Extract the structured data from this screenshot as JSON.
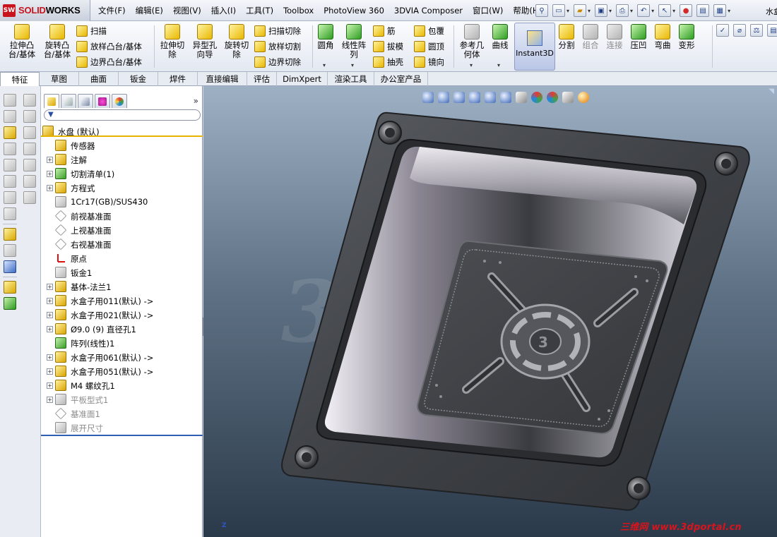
{
  "app": {
    "logo_text_prefix": "SOLID",
    "logo_text_suffix": "WORKS",
    "document_title": "水盒"
  },
  "menus": [
    "文件(F)",
    "编辑(E)",
    "视图(V)",
    "插入(I)",
    "工具(T)",
    "Toolbox",
    "PhotoView 360",
    "3DVIA Composer",
    "窗口(W)",
    "帮助(H)"
  ],
  "ribbon": {
    "extrude_boss": "拉伸凸\n台/基体",
    "revolve_boss": "旋转凸\n台/基体",
    "sweep": "扫描",
    "loft_boss": "放样凸台/基体",
    "boundary_boss": "边界凸台/基体",
    "extrude_cut": "拉伸切\n除",
    "hole_wizard": "异型孔\n向导",
    "revolve_cut": "旋转切\n除",
    "swept_cut": "扫描切除",
    "lofted_cut": "放样切割",
    "boundary_cut": "边界切除",
    "fillet": "圆角",
    "linear_pattern": "线性阵\n列",
    "rib": "筋",
    "draft": "拔模",
    "shell": "抽壳",
    "wrap": "包覆",
    "dome": "圆顶",
    "mirror": "镜向",
    "reference_geometry": "参考几\n何体",
    "curves": "曲线",
    "instant3d": "Instant3D",
    "split": "分割",
    "combine": "组合",
    "join": "连接",
    "indent": "压凹",
    "flex": "弯曲",
    "deform": "变形"
  },
  "tabs": [
    "特征",
    "草图",
    "曲面",
    "钣金",
    "焊件",
    "直接编辑",
    "评估",
    "DimXpert",
    "渲染工具",
    "办公室产品"
  ],
  "feature_tree": {
    "expand_label": "»",
    "root": "水盘  (默认)",
    "items": [
      {
        "label": "传感器",
        "icon": "sensor-icon",
        "expand": false,
        "dim": false
      },
      {
        "label": "注解",
        "icon": "annotations-icon",
        "expand": true,
        "dim": false
      },
      {
        "label": "切割清单(1)",
        "icon": "cut-list-icon",
        "expand": true,
        "dim": false
      },
      {
        "label": "方程式",
        "icon": "equations-icon",
        "expand": true,
        "dim": false
      },
      {
        "label": "1Cr17(GB)/SUS430",
        "icon": "material-icon",
        "expand": false,
        "dim": false
      },
      {
        "label": "前视基准面",
        "icon": "plane-icon",
        "expand": false,
        "dim": false
      },
      {
        "label": "上视基准面",
        "icon": "plane-icon",
        "expand": false,
        "dim": false
      },
      {
        "label": "右视基准面",
        "icon": "plane-icon",
        "expand": false,
        "dim": false
      },
      {
        "label": "原点",
        "icon": "origin-icon",
        "expand": false,
        "dim": false
      },
      {
        "label": "钣金1",
        "icon": "sheet-metal-icon",
        "expand": false,
        "dim": false
      },
      {
        "label": "基体-法兰1",
        "icon": "base-flange-icon",
        "expand": true,
        "dim": false
      },
      {
        "label": "水盒子用011(默认) ->",
        "icon": "forming-tool-icon",
        "expand": true,
        "dim": false
      },
      {
        "label": "水盒子用021(默认) ->",
        "icon": "forming-tool-icon",
        "expand": true,
        "dim": false
      },
      {
        "label": "Ø9.0 (9) 直径孔1",
        "icon": "hole-icon",
        "expand": true,
        "dim": false
      },
      {
        "label": "阵列(线性)1",
        "icon": "pattern-icon",
        "expand": false,
        "dim": false
      },
      {
        "label": "水盒子用061(默认) ->",
        "icon": "forming-tool-icon",
        "expand": true,
        "dim": false
      },
      {
        "label": "水盒子用051(默认) ->",
        "icon": "forming-tool-icon",
        "expand": true,
        "dim": false
      },
      {
        "label": "M4 螺纹孔1",
        "icon": "hole-icon",
        "expand": true,
        "dim": false
      },
      {
        "label": "平板型式1",
        "icon": "flat-pattern-icon",
        "expand": true,
        "dim": true
      },
      {
        "label": "基准面1",
        "icon": "plane-icon",
        "expand": false,
        "dim": true
      },
      {
        "label": "展开尺寸",
        "icon": "sketch-icon",
        "expand": false,
        "dim": true
      }
    ]
  },
  "viewport": {
    "triad_label": "Z",
    "watermark": "三维网 www.3dportal.cn"
  },
  "colors": {
    "accent_selected": "#e5b400",
    "brand_red": "#c8141c"
  }
}
